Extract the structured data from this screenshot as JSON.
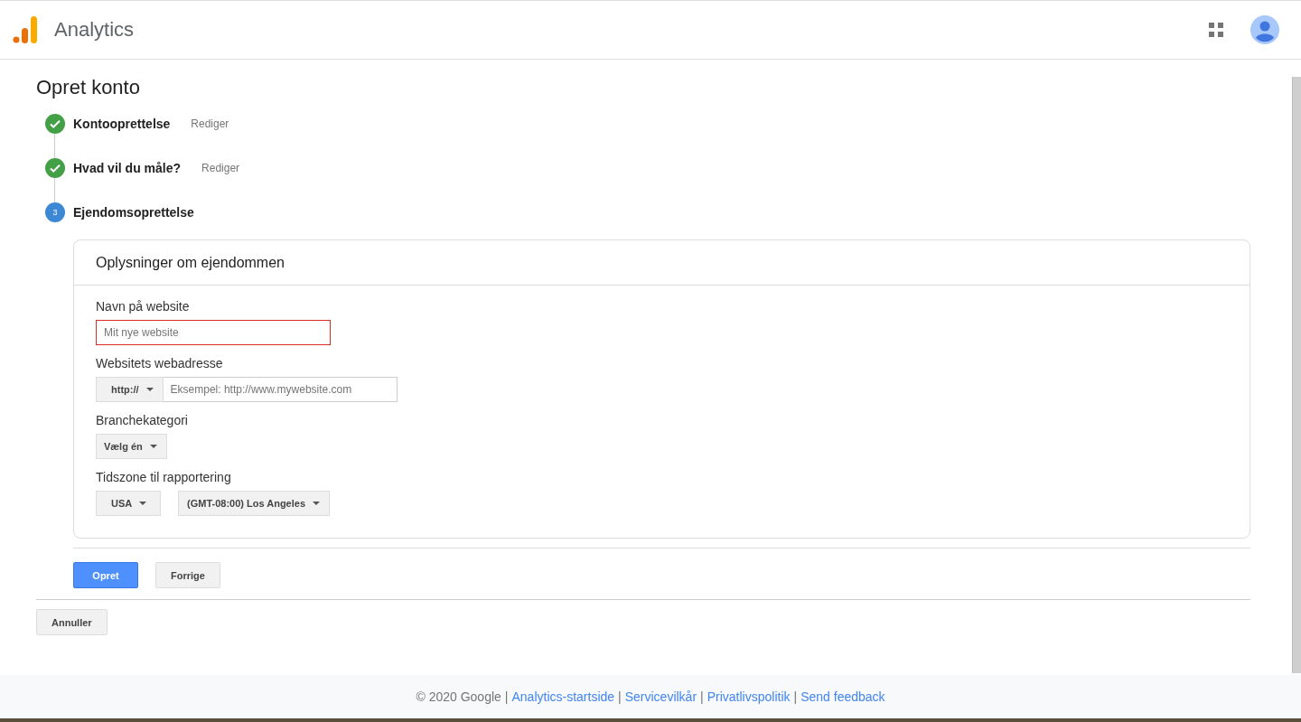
{
  "header": {
    "title": "Analytics"
  },
  "page": {
    "title": "Opret konto"
  },
  "steps": [
    {
      "kind": "done",
      "label": "Kontooprettelse",
      "action": "Rediger"
    },
    {
      "kind": "done",
      "label": "Hvad vil du måle?",
      "action": "Rediger"
    },
    {
      "kind": "current",
      "number": "3",
      "label": "Ejendomsoprettelse"
    }
  ],
  "card": {
    "title": "Oplysninger om ejendommen",
    "name_field": {
      "label": "Navn på website",
      "placeholder": "Mit nye website",
      "error": true
    },
    "url_field": {
      "label": "Websitets webadresse",
      "protocol": "http://",
      "placeholder": "Eksempel: http://www.mywebsite.com"
    },
    "category": {
      "label": "Branchekategori",
      "value": "Vælg én"
    },
    "timezone": {
      "label": "Tidszone til rapportering",
      "country": "USA",
      "zone": "(GMT-08:00) Los Angeles"
    }
  },
  "buttons": [
    {
      "label": "Opret",
      "primary": true
    },
    {
      "label": "Forrige",
      "primary": false
    }
  ],
  "cancel": "Annuller",
  "footer": [
    {
      "kind": "text",
      "text": "© 2020 Google"
    },
    {
      "kind": "separator",
      "text": "|"
    },
    {
      "kind": "link",
      "text": "Analytics-startside"
    },
    {
      "kind": "separator",
      "text": "|"
    },
    {
      "kind": "link",
      "text": "Servicevilkår"
    },
    {
      "kind": "separator",
      "text": "|"
    },
    {
      "kind": "link",
      "text": "Privatlivspolitik"
    },
    {
      "kind": "separator",
      "text": "|"
    },
    {
      "kind": "link",
      "text": "Send feedback"
    }
  ]
}
